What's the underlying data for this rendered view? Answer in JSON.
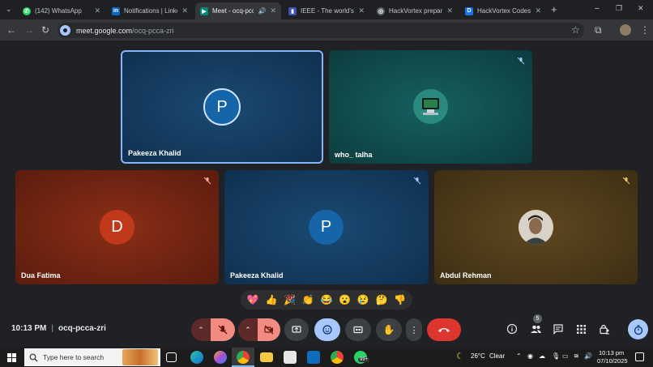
{
  "browser": {
    "tabs": [
      {
        "title": "(142) WhatsApp",
        "fav_color": "#25d366",
        "fav_glyph": "✆"
      },
      {
        "title": "Notifications | LinkedIn",
        "fav_color": "#0a66c2",
        "fav_glyph": "in"
      },
      {
        "title": "Meet - ocq-pcca",
        "fav_color": "#00897b",
        "fav_glyph": "▶",
        "active": true
      },
      {
        "title": "IEEE - The world's la",
        "fav_color": "#3f51b5",
        "fav_glyph": "▮"
      },
      {
        "title": "HackVortex preparat",
        "fav_color": "#5f6368",
        "fav_glyph": "◎"
      },
      {
        "title": "HackVortex Codesto",
        "fav_color": "#1a73e8",
        "fav_glyph": "D"
      }
    ],
    "new_tab_label": "+",
    "url_host": "meet.google.com",
    "url_path": "/ocq-pcca-zri",
    "window_controls": [
      "–",
      "❐",
      "✕"
    ]
  },
  "participants": [
    {
      "name": "Pakeeza Khalid",
      "initial": "P",
      "bg": "#12395c",
      "avatar_color": "#1565a8",
      "muted": false,
      "speaking": true
    },
    {
      "name": "who_ talha",
      "initial": "",
      "bg": "#0f4a4a",
      "avatar_color": "#2a8a7d",
      "muted": true
    },
    {
      "name": "Dua Fatima",
      "initial": "D",
      "bg": "#7a2512",
      "avatar_color": "#c0391b",
      "muted": true
    },
    {
      "name": "Pakeeza Khalid",
      "initial": "P",
      "bg": "#12395c",
      "avatar_color": "#1565a8",
      "muted": true
    },
    {
      "name": "Abdul Rehman",
      "initial": "",
      "bg": "#4d3a17",
      "avatar_color": "#9d8568",
      "muted": true
    }
  ],
  "reactions": [
    "💖",
    "👍",
    "🎉",
    "👏",
    "😂",
    "😮",
    "😢",
    "🤔",
    "👎"
  ],
  "controls": {
    "time": "10:13 PM",
    "separator": "|",
    "meeting_code": "ocq-pcca-zri",
    "people_count": "5"
  },
  "taskbar": {
    "search_placeholder": "Type here to search",
    "weather_temp": "26°C",
    "weather_text": "Clear",
    "clock_time": "10:13 pm",
    "clock_date": "07/10/2025",
    "badge": "99+"
  }
}
